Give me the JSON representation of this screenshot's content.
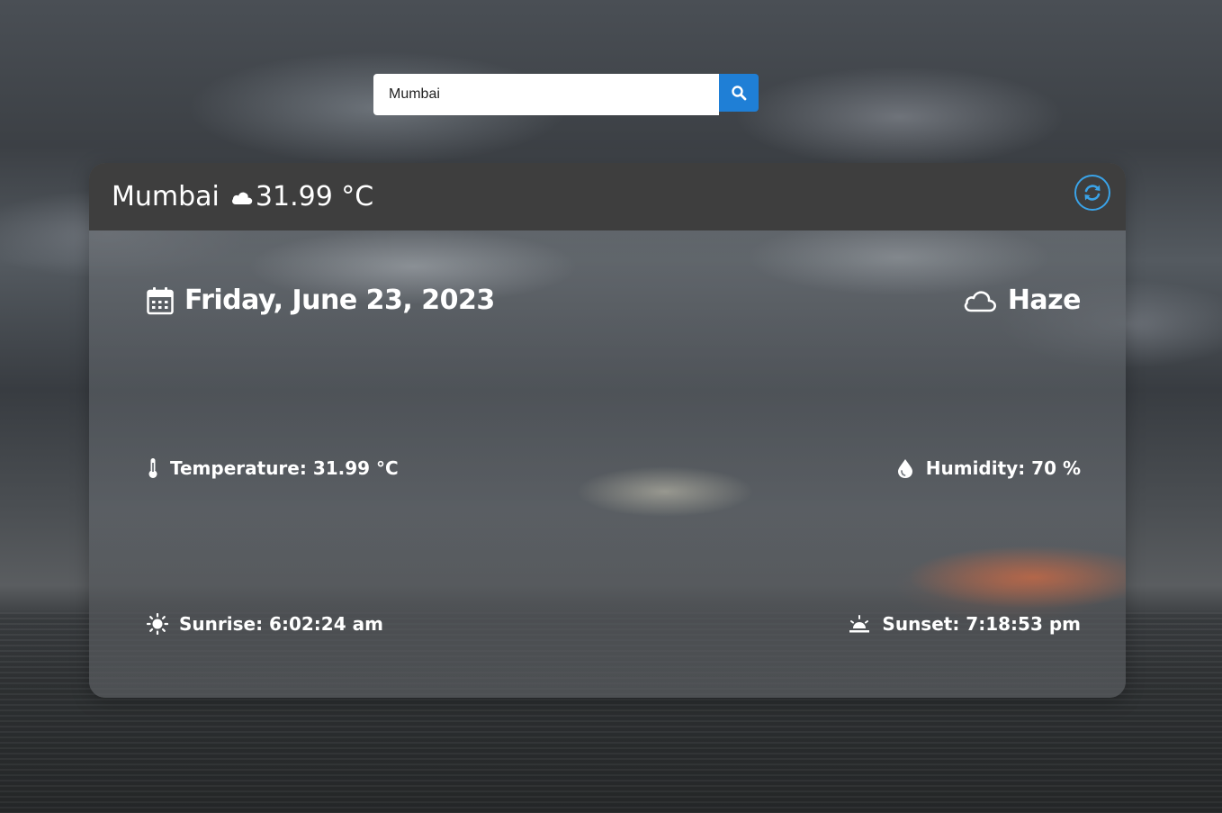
{
  "search": {
    "value": "Mumbai",
    "button_icon": "search-icon"
  },
  "header": {
    "city": "Mumbai",
    "temperature": "31.99 °C",
    "weather_icon": "cloud-icon",
    "refresh_icon": "refresh-icon"
  },
  "details": {
    "date": "Friday, June 23, 2023",
    "condition": "Haze",
    "temperature": "Temperature: 31.99 °C",
    "humidity": "Humidity: 70 %",
    "sunrise": "Sunrise: 6:02:24 am",
    "sunset": "Sunset: 7:18:53 pm"
  },
  "colors": {
    "header_bg": "#3e3e3e",
    "search_button": "#1f7fd6",
    "refresh_ring": "#3aa3e8",
    "text": "#ffffff"
  }
}
